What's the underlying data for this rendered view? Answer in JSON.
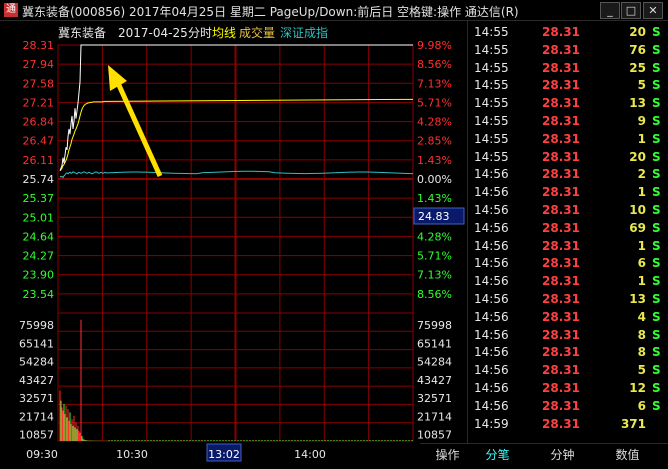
{
  "window": {
    "title": "冀东装备(000856) 2017年04月25日 星期二 PageUp/Down:前后日 空格键:操作 通达信(R)",
    "min_label": "_",
    "max_label": "□",
    "close_label": "✕"
  },
  "chart_header": {
    "stock_name": "冀东装备",
    "date": "2017-04-25",
    "mode": "分时",
    "legend_avg": "均线",
    "legend_vol": "成交量",
    "legend_index": "深证成指"
  },
  "price_axis": {
    "left_labels": [
      "28.31",
      "27.94",
      "27.58",
      "27.21",
      "26.84",
      "26.47",
      "26.11",
      "25.74",
      "25.37",
      "25.01",
      "24.64",
      "24.27",
      "23.90",
      "23.54"
    ],
    "right_labels": [
      "9.98%",
      "8.56%",
      "7.13%",
      "5.71%",
      "4.28%",
      "2.85%",
      "1.43%",
      "0.00%",
      "1.43%",
      "2.85%",
      "4.28%",
      "5.71%",
      "7.13%",
      "8.56%"
    ],
    "cursor_price": "24.83"
  },
  "volume_axis": {
    "labels": [
      "75998",
      "65141",
      "54284",
      "43427",
      "32571",
      "21714",
      "10857"
    ]
  },
  "time_axis": {
    "labels": [
      "09:30",
      "10:30",
      "13:02",
      "14:00"
    ]
  },
  "colors": {
    "price_line": "#ffffff",
    "avg_line": "#ffff00",
    "index_line": "#30c0c0",
    "up": "#ff3030",
    "down": "#30ff30",
    "grid": "#8a0000",
    "arrow": "#ffe000"
  },
  "chart_data": {
    "type": "line",
    "prev_close": 25.74,
    "ylim": [
      23.54,
      28.31
    ],
    "price": [
      25.9,
      25.95,
      26.0,
      26.15,
      26.05,
      26.2,
      26.35,
      26.3,
      26.55,
      26.7,
      26.6,
      26.8,
      26.95,
      26.7,
      26.85,
      27.1,
      26.9,
      27.05,
      27.2,
      27.4,
      27.6,
      28.31,
      28.31,
      28.31,
      28.31,
      28.31,
      28.31,
      28.31,
      28.31,
      28.31,
      28.31,
      28.31,
      28.31,
      28.31,
      28.31,
      28.31,
      28.31,
      28.31,
      28.31,
      28.31,
      28.31,
      28.31,
      28.31,
      28.31,
      28.31,
      28.31,
      28.31,
      28.31
    ],
    "avg": [
      25.9,
      25.92,
      25.95,
      26.0,
      26.02,
      26.06,
      26.1,
      26.15,
      26.22,
      26.3,
      26.36,
      26.42,
      26.5,
      26.55,
      26.6,
      26.66,
      26.7,
      26.75,
      26.8,
      26.87,
      26.95,
      27.02,
      27.08,
      27.12,
      27.15,
      27.17,
      27.18,
      27.19,
      27.2,
      27.2,
      27.21,
      27.21,
      27.21,
      27.22,
      27.22,
      27.22,
      27.22,
      27.22,
      27.22,
      27.22,
      27.22,
      27.22,
      27.22,
      27.22,
      27.23,
      27.23,
      27.23,
      27.23
    ],
    "index": [
      25.8,
      25.78,
      25.79,
      25.77,
      25.8,
      25.82,
      25.85,
      25.86,
      25.84,
      25.86,
      25.87,
      25.85,
      25.86,
      25.88,
      25.87,
      25.86,
      25.85,
      25.84,
      25.86,
      25.87,
      25.86,
      25.85,
      25.86,
      25.87,
      25.88,
      25.87,
      25.86,
      25.85,
      25.86,
      25.87,
      25.86,
      25.85,
      25.84,
      25.85,
      25.86,
      25.87,
      25.88,
      25.87,
      25.86,
      25.85,
      25.86,
      25.87,
      25.86,
      25.85,
      25.86,
      25.87,
      25.86,
      25.86
    ],
    "volume": [
      30000,
      24000,
      20000,
      18000,
      22000,
      16000,
      21000,
      14000,
      19000,
      12000,
      17000,
      10000,
      13000,
      9000,
      15000,
      8000,
      11000,
      7000,
      9000,
      6000,
      5000,
      72000,
      3000,
      1500,
      900,
      600,
      500,
      400,
      300,
      300,
      250,
      250,
      200,
      200,
      180,
      180,
      150,
      150,
      150,
      120,
      120,
      120,
      100,
      100,
      100,
      90,
      90,
      80
    ],
    "volume_up": [
      true,
      false,
      true,
      true,
      false,
      true,
      true,
      false,
      true,
      true,
      false,
      true,
      true,
      false,
      true,
      false,
      true,
      false,
      true,
      true,
      true,
      true,
      false,
      true,
      false,
      true,
      false,
      true,
      false,
      true,
      false,
      true,
      false,
      true,
      false,
      true,
      false,
      true,
      false,
      true,
      false,
      true,
      false,
      true,
      false,
      true,
      false,
      true
    ],
    "vol_max": 75998
  },
  "ticks": [
    {
      "time": "14:55",
      "price": "28.31",
      "vol": "20",
      "side": "S"
    },
    {
      "time": "14:55",
      "price": "28.31",
      "vol": "76",
      "side": "S"
    },
    {
      "time": "14:55",
      "price": "28.31",
      "vol": "25",
      "side": "S"
    },
    {
      "time": "14:55",
      "price": "28.31",
      "vol": "5",
      "side": "S"
    },
    {
      "time": "14:55",
      "price": "28.31",
      "vol": "13",
      "side": "S"
    },
    {
      "time": "14:55",
      "price": "28.31",
      "vol": "9",
      "side": "S"
    },
    {
      "time": "14:55",
      "price": "28.31",
      "vol": "1",
      "side": "S"
    },
    {
      "time": "14:55",
      "price": "28.31",
      "vol": "20",
      "side": "S"
    },
    {
      "time": "14:56",
      "price": "28.31",
      "vol": "2",
      "side": "S"
    },
    {
      "time": "14:56",
      "price": "28.31",
      "vol": "1",
      "side": "S"
    },
    {
      "time": "14:56",
      "price": "28.31",
      "vol": "10",
      "side": "S"
    },
    {
      "time": "14:56",
      "price": "28.31",
      "vol": "69",
      "side": "S"
    },
    {
      "time": "14:56",
      "price": "28.31",
      "vol": "1",
      "side": "S"
    },
    {
      "time": "14:56",
      "price": "28.31",
      "vol": "6",
      "side": "S"
    },
    {
      "time": "14:56",
      "price": "28.31",
      "vol": "1",
      "side": "S"
    },
    {
      "time": "14:56",
      "price": "28.31",
      "vol": "13",
      "side": "S"
    },
    {
      "time": "14:56",
      "price": "28.31",
      "vol": "4",
      "side": "S"
    },
    {
      "time": "14:56",
      "price": "28.31",
      "vol": "8",
      "side": "S"
    },
    {
      "time": "14:56",
      "price": "28.31",
      "vol": "8",
      "side": "S"
    },
    {
      "time": "14:56",
      "price": "28.31",
      "vol": "5",
      "side": "S"
    },
    {
      "time": "14:56",
      "price": "28.31",
      "vol": "12",
      "side": "S"
    },
    {
      "time": "14:56",
      "price": "28.31",
      "vol": "6",
      "side": "S"
    },
    {
      "time": "14:59",
      "price": "28.31",
      "vol": "371",
      "side": ""
    }
  ],
  "tabs": [
    "操作",
    "分笔",
    "分钟",
    "数值"
  ],
  "active_tab": 1
}
